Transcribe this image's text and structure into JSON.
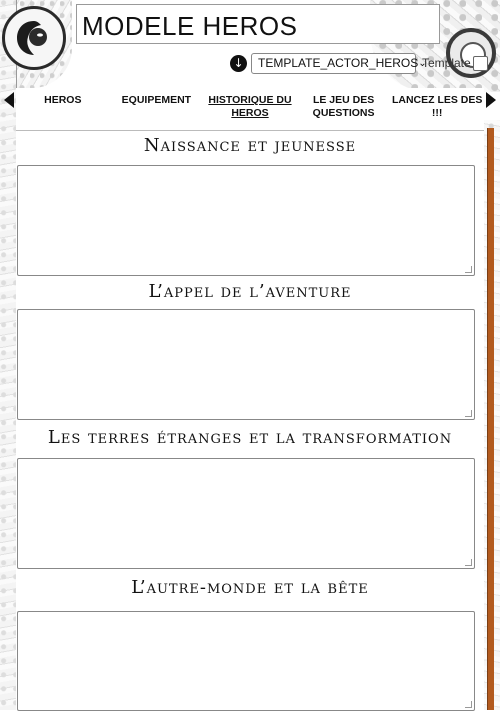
{
  "header": {
    "character_name": "MODELE HEROS",
    "sheet_template_value": "TEMPLATE_ACTOR_HEROS",
    "template_label": "Template"
  },
  "tabs": [
    {
      "label": "HEROS"
    },
    {
      "label": "EQUIPEMENT"
    },
    {
      "label": "HISTORIQUE DU HEROS"
    },
    {
      "label": "LE JEU DES QUESTIONS"
    },
    {
      "label": "LANCEZ LES DES !!!"
    }
  ],
  "sections": [
    {
      "title": "Naissance et jeunesse",
      "value": ""
    },
    {
      "title": "L’appel de l’aventure",
      "value": ""
    },
    {
      "title": "Les terres étranges et la transformation",
      "value": ""
    },
    {
      "title": "L’autre-monde et la bête",
      "value": ""
    }
  ],
  "icons": {
    "download": "download-icon",
    "emblem": "faction-emblem-icon",
    "gear": "gear-ornament-icon",
    "prev": "arrow-left-icon",
    "next": "arrow-right-icon"
  },
  "colors": {
    "scrollbar": "#b25a1e"
  }
}
